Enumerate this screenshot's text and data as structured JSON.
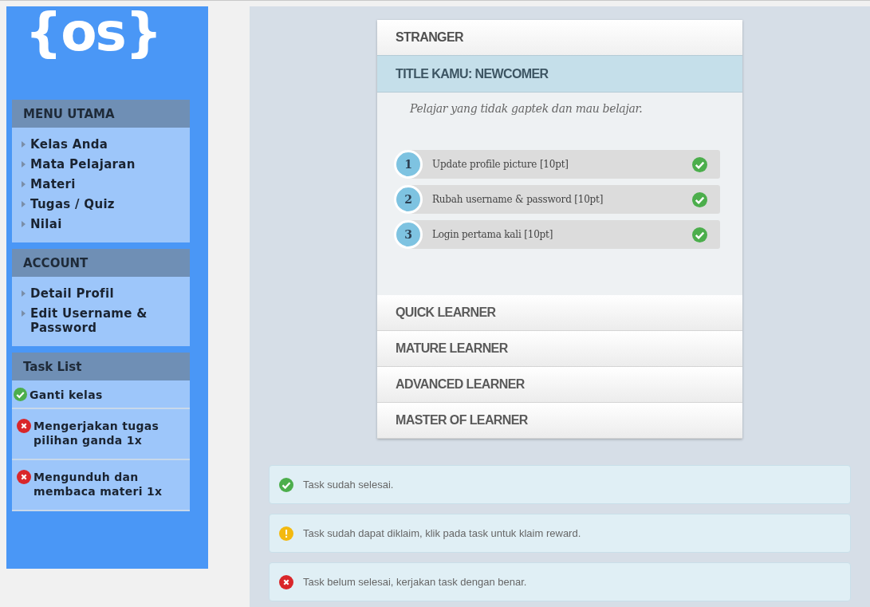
{
  "logo": "{os}",
  "sidebar": {
    "sections": [
      {
        "title": "MENU UTAMA",
        "kind": "menu",
        "items": [
          {
            "label": "Kelas Anda"
          },
          {
            "label": "Mata Pelajaran"
          },
          {
            "label": "Materi"
          },
          {
            "label": "Tugas / Quiz"
          },
          {
            "label": "Nilai"
          }
        ]
      },
      {
        "title": "ACCOUNT",
        "kind": "menu",
        "items": [
          {
            "label": "Detail Profil"
          },
          {
            "label": "Edit Username & Password"
          }
        ]
      },
      {
        "title": "Task List",
        "kind": "tasks",
        "items": [
          {
            "label": "Ganti kelas",
            "done": true
          },
          {
            "label": "Mengerjakan tugas pilihan ganda 1x",
            "done": false
          },
          {
            "label": "Mengunduh dan membaca materi 1x",
            "done": false
          }
        ]
      }
    ]
  },
  "levels": [
    {
      "title": "STRANGER",
      "expanded": true,
      "heading": "TITLE KAMU: NEWCOMER",
      "description": "Pelajar yang tidak gaptek dan mau belajar.",
      "tasks": [
        {
          "number": "1",
          "label": "Update profile picture [10pt]",
          "done": true
        },
        {
          "number": "2",
          "label": "Rubah username & password [10pt]",
          "done": true
        },
        {
          "number": "3",
          "label": "Login pertama kali [10pt]",
          "done": true
        }
      ]
    },
    {
      "title": "QUICK LEARNER",
      "expanded": false
    },
    {
      "title": "MATURE LEARNER",
      "expanded": false
    },
    {
      "title": "ADVANCED LEARNER",
      "expanded": false
    },
    {
      "title": "MASTER OF LEARNER",
      "expanded": false
    }
  ],
  "alerts": [
    {
      "kind": "success",
      "text": "Task sudah selesai."
    },
    {
      "kind": "warning",
      "text": "Task sudah dapat diklaim, klik pada task untuk klaim reward."
    },
    {
      "kind": "error",
      "text": "Task belum selesai, kerjakan task dengan benar."
    }
  ]
}
